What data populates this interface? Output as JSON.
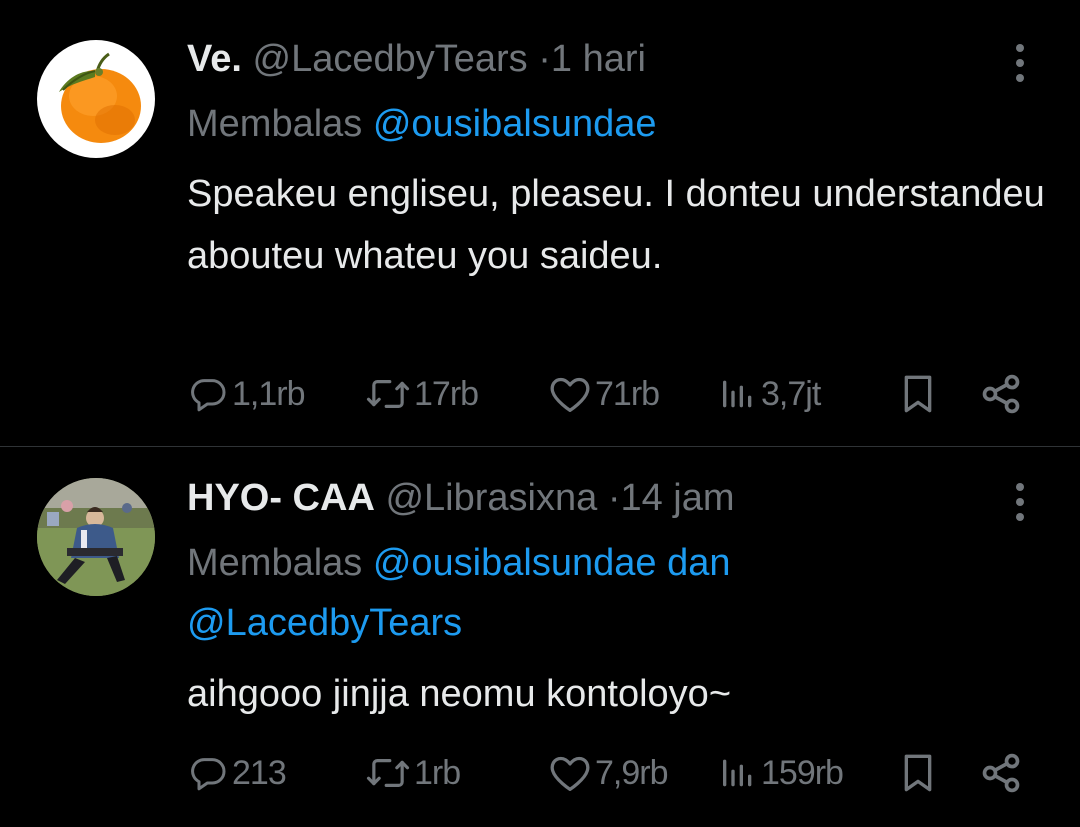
{
  "tweets": [
    {
      "name": "Ve.",
      "handle": "@LacedbyTears",
      "separator": "·",
      "time": "1 hari",
      "reply_prefix": "Membalas ",
      "mentions": [
        "@ousibalsundae"
      ],
      "mention_joiner": "",
      "text": "Speakeu engliseu, pleaseu. I donteu understandeu abouteu whateu you saideu.",
      "avatar_icon": "orange-fruit-avatar",
      "stats": {
        "replies": "1,1rb",
        "retweets": "17rb",
        "likes": "71rb",
        "views": "3,7jt"
      }
    },
    {
      "name": "HYO- CAA",
      "handle": "@Librasixna",
      "separator": "·",
      "time": "14 jam",
      "reply_prefix": "Membalas ",
      "mentions": [
        "@ousibalsundae",
        "@LacedbyTears"
      ],
      "mention_joiner": " dan ",
      "text": "aihgooo jinjja neomu kontoloyo~",
      "avatar_icon": "person-photo-avatar",
      "stats": {
        "replies": "213",
        "retweets": "1rb",
        "likes": "7,9rb",
        "views": "159rb"
      }
    }
  ],
  "colors": {
    "background": "#000000",
    "primary_text": "#e7e9ea",
    "secondary_text": "#71767b",
    "link": "#1d9bf0",
    "divider": "#2f3336"
  },
  "icons": {
    "reply": "reply-icon",
    "retweet": "retweet-icon",
    "like": "heart-icon",
    "views": "views-icon",
    "bookmark": "bookmark-icon",
    "share": "share-icon",
    "more": "more-vertical-icon"
  }
}
